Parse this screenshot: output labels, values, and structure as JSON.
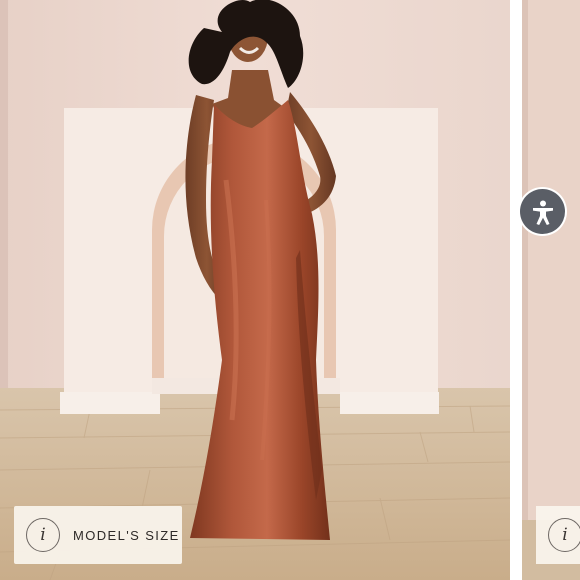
{
  "gallery": {
    "main_slide": {
      "model_size_button": {
        "icon_glyph": "i",
        "label": "MODEL'S SIZE"
      }
    },
    "next_slide": {
      "model_size_button": {
        "icon_glyph": "i"
      }
    }
  },
  "accessibility_button": {
    "icon": "accessibility-person-icon"
  },
  "colors": {
    "wall": "#eedad2",
    "dress": "#a04a2c",
    "floor": "#cdb596",
    "accessibility_button": "#5a5e66"
  }
}
